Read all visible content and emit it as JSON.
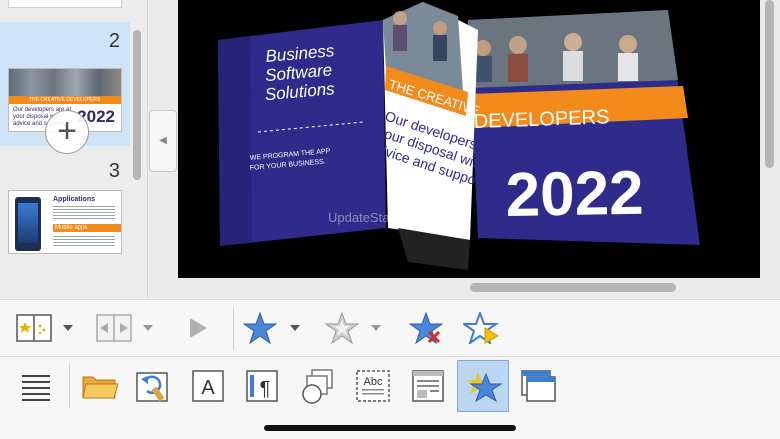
{
  "slides": [
    {
      "number": "2",
      "header": "THE CREATIVE DEVELOPERS",
      "body": "Our developers are at your disposal with advice and support.",
      "year": "2022"
    },
    {
      "number": "3",
      "title": "Applications",
      "bar": "Mobile apps"
    }
  ],
  "slide": {
    "left_title": "Business Software Solutions",
    "left_sub1": "WE PROGRAM THE APP",
    "left_sub2": "FOR YOUR BUSINESS.",
    "page_banner": "THE CREATIVE",
    "page_text": "Our developers are at your disposal with advice and support",
    "banner": "DEVELOPERS",
    "year": "2022",
    "watermark": "UpdateStar.com"
  },
  "toolbar1": [
    {
      "name": "animation-scheme-button",
      "icon": "slide-transition-icon",
      "has_dropdown": true
    },
    {
      "name": "transition-effect-button",
      "icon": "transition-icon",
      "has_dropdown": true,
      "disabled": true
    },
    {
      "name": "play-button",
      "icon": "play-icon",
      "disabled": true
    },
    {
      "name": "add-animation-button",
      "icon": "star-icon",
      "has_dropdown": true
    },
    {
      "name": "animation-effect-button",
      "icon": "star-outline-icon",
      "has_dropdown": true,
      "disabled": true
    },
    {
      "name": "remove-animation-button",
      "icon": "star-remove-icon"
    },
    {
      "name": "preview-animation-button",
      "icon": "star-play-icon"
    }
  ],
  "toolbar2": [
    {
      "name": "menu-button",
      "icon": "hamburger-icon"
    },
    {
      "name": "open-button",
      "icon": "folder-icon"
    },
    {
      "name": "undo-format-button",
      "icon": "format-paint-icon"
    },
    {
      "name": "character-button",
      "icon": "character-icon",
      "label": "A"
    },
    {
      "name": "paragraph-button",
      "icon": "paragraph-icon",
      "label": "¶"
    },
    {
      "name": "objects-button",
      "icon": "shapes-icon"
    },
    {
      "name": "textframe-button",
      "icon": "textbox-icon",
      "label": "Abc"
    },
    {
      "name": "layout-button",
      "icon": "layout-icon"
    },
    {
      "name": "animations-button",
      "icon": "animation-star-icon",
      "active": true
    },
    {
      "name": "window-button",
      "icon": "windows-icon"
    }
  ],
  "colors": {
    "accent": "#3b7dd8",
    "book_blue": "#2e2b8a",
    "orange": "#f28a1c",
    "selected_slide": "#cfe3f6"
  }
}
